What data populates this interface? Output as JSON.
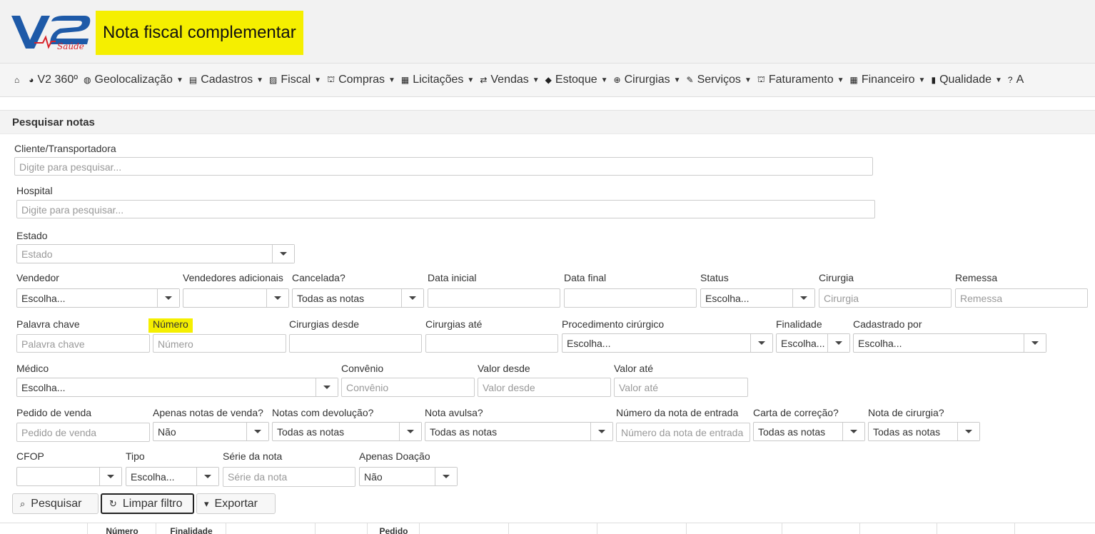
{
  "header": {
    "title": "Nota fiscal complementar",
    "logo_main": "V2",
    "logo_sub": "Saúde"
  },
  "nav": {
    "items": [
      {
        "icon": "home-icon",
        "glyph": "⌂",
        "label": "",
        "caret": false
      },
      {
        "icon": "pie-chart-icon",
        "glyph": "◕",
        "label": "V2 360º",
        "caret": false
      },
      {
        "icon": "globe-icon",
        "glyph": "◍",
        "label": "Geolocalização",
        "caret": true
      },
      {
        "icon": "save-icon",
        "glyph": "▤",
        "label": "Cadastros",
        "caret": true
      },
      {
        "icon": "fiscal-icon",
        "glyph": "▨",
        "label": "Fiscal",
        "caret": true
      },
      {
        "icon": "bank-icon",
        "glyph": "⛫",
        "label": "Compras",
        "caret": true
      },
      {
        "icon": "building-icon",
        "glyph": "▦",
        "label": "Licitações",
        "caret": true
      },
      {
        "icon": "transfer-icon",
        "glyph": "⇄",
        "label": "Vendas",
        "caret": true
      },
      {
        "icon": "tag-icon",
        "glyph": "◆",
        "label": "Estoque",
        "caret": true
      },
      {
        "icon": "plus-circle-icon",
        "glyph": "⊕",
        "label": "Cirurgias",
        "caret": true
      },
      {
        "icon": "wrench-icon",
        "glyph": "✎",
        "label": "Serviços",
        "caret": true
      },
      {
        "icon": "bank-icon",
        "glyph": "⛫",
        "label": "Faturamento",
        "caret": true
      },
      {
        "icon": "calculator-icon",
        "glyph": "▦",
        "label": "Financeiro",
        "caret": true
      },
      {
        "icon": "book-icon",
        "glyph": "▮",
        "label": "Qualidade",
        "caret": true
      },
      {
        "icon": "question-icon",
        "glyph": "?",
        "label": "A",
        "caret": false
      }
    ]
  },
  "section": {
    "title": "Pesquisar notas"
  },
  "form": {
    "cliente": {
      "label": "Cliente/Transportadora",
      "placeholder": "Digite para pesquisar..."
    },
    "hospital": {
      "label": "Hospital",
      "placeholder": "Digite para pesquisar..."
    },
    "estado": {
      "label": "Estado",
      "value": "Estado"
    },
    "vendedor": {
      "label": "Vendedor",
      "value": "Escolha..."
    },
    "vendedores_adicionais": {
      "label": "Vendedores adicionais",
      "value": ""
    },
    "cancelada": {
      "label": "Cancelada?",
      "value": "Todas as notas"
    },
    "data_inicial": {
      "label": "Data inicial",
      "value": ""
    },
    "data_final": {
      "label": "Data final",
      "value": ""
    },
    "status": {
      "label": "Status",
      "value": "Escolha..."
    },
    "cirurgia": {
      "label": "Cirurgia",
      "placeholder": "Cirurgia"
    },
    "remessa": {
      "label": "Remessa",
      "placeholder": "Remessa"
    },
    "palavra_chave": {
      "label": "Palavra chave",
      "placeholder": "Palavra chave"
    },
    "numero": {
      "label": "Número",
      "placeholder": "Número"
    },
    "cirurgias_desde": {
      "label": "Cirurgias desde",
      "value": ""
    },
    "cirurgias_ate": {
      "label": "Cirurgias até",
      "value": ""
    },
    "procedimento": {
      "label": "Procedimento cirúrgico",
      "value": "Escolha..."
    },
    "finalidade": {
      "label": "Finalidade",
      "value": "Escolha..."
    },
    "cadastrado_por": {
      "label": "Cadastrado por",
      "value": "Escolha..."
    },
    "medico": {
      "label": "Médico",
      "value": "Escolha..."
    },
    "convenio": {
      "label": "Convênio",
      "placeholder": "Convênio"
    },
    "valor_desde": {
      "label": "Valor desde",
      "placeholder": "Valor desde"
    },
    "valor_ate": {
      "label": "Valor até",
      "placeholder": "Valor até"
    },
    "pedido_venda": {
      "label": "Pedido de venda",
      "placeholder": "Pedido de venda"
    },
    "apenas_venda": {
      "label": "Apenas notas de venda?",
      "value": "Não"
    },
    "devolucao": {
      "label": "Notas com devolução?",
      "value": "Todas as notas"
    },
    "avulsa": {
      "label": "Nota avulsa?",
      "value": "Todas as notas"
    },
    "nota_entrada": {
      "label": "Número da nota de entrada",
      "placeholder": "Número da nota de entrada"
    },
    "carta_correcao": {
      "label": "Carta de correção?",
      "value": "Todas as notas"
    },
    "nota_cirurgia": {
      "label": "Nota de cirurgia?",
      "value": "Todas as notas"
    },
    "cfop": {
      "label": "CFOP",
      "value": ""
    },
    "tipo": {
      "label": "Tipo",
      "value": "Escolha..."
    },
    "serie": {
      "label": "Série da nota",
      "placeholder": "Série da nota"
    },
    "apenas_doacao": {
      "label": "Apenas Doação",
      "value": "Não"
    }
  },
  "buttons": {
    "pesquisar": "Pesquisar",
    "limpar": "Limpar filtro",
    "exportar": "Exportar"
  },
  "table": {
    "headers": [
      "Número",
      "Finalidade",
      "Pedido"
    ]
  },
  "colors": {
    "highlight": "#f5ef00",
    "logo_blue": "#1e5aa8",
    "logo_red": "#d8232a"
  }
}
